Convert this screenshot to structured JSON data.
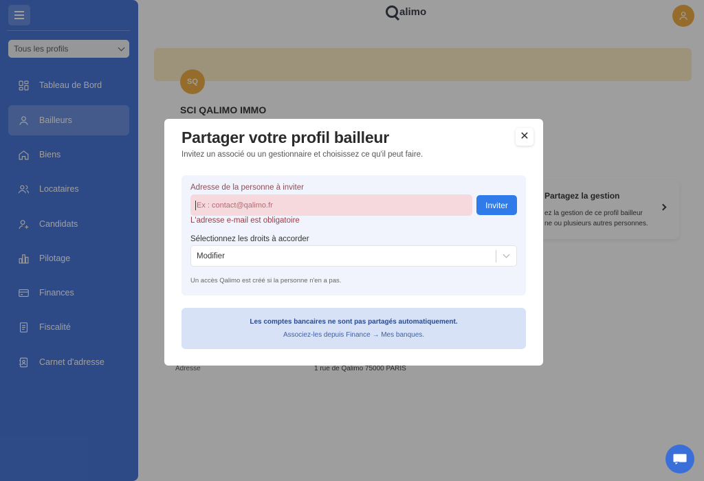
{
  "sidebar": {
    "profile_select": "Tous les profils",
    "items": [
      {
        "label": "Tableau de Bord",
        "icon": "dashboard-icon"
      },
      {
        "label": "Bailleurs",
        "icon": "person-icon",
        "active": true
      },
      {
        "label": "Biens",
        "icon": "home-icon"
      },
      {
        "label": "Locataires",
        "icon": "people-icon"
      },
      {
        "label": "Candidats",
        "icon": "person-add-icon"
      },
      {
        "label": "Pilotage",
        "icon": "bar-chart-icon"
      },
      {
        "label": "Finances",
        "icon": "credit-card-icon"
      },
      {
        "label": "Fiscalité",
        "icon": "document-icon"
      },
      {
        "label": "Carnet d'adresse",
        "icon": "address-book-icon"
      }
    ]
  },
  "header": {
    "logo": "alimo"
  },
  "page": {
    "avatar_initials": "SQ",
    "company": "SCI QALIMO IMMO",
    "gestion_card": {
      "title": "Partagez la gestion",
      "line1": "ez la gestion de ce profil bailleur",
      "line2": "ne ou plusieurs autres personnes."
    },
    "address_label": "Adresse",
    "address_value": "1 rue de Qalimo 75000 PARIS"
  },
  "modal": {
    "title": "Partager votre profil bailleur",
    "subtitle": "Invitez un associé ou un gestionnaire et choisissez ce qu'il peut faire.",
    "close": "✕",
    "email_label": "Adresse de la personne à inviter",
    "email_placeholder": "Ex : contact@qalimo.fr",
    "invite_label": "Inviter",
    "email_error": "L'adresse e-mail est obligatoire",
    "rights_label": "Sélectionnez les droits à accorder",
    "rights_value": "Modifier",
    "note": "Un accès Qalimo est créé si la personne n'en a pas.",
    "info_bold": "Les comptes bancaires ne sont pas partagés automatiquement.",
    "info_link": "Associez-les depuis Finance → Mes banques."
  },
  "colors": {
    "sidebar": "#3d6fd8",
    "accent": "#2f7be9",
    "avatar": "#f2a93b",
    "error": "#9c3a45"
  }
}
